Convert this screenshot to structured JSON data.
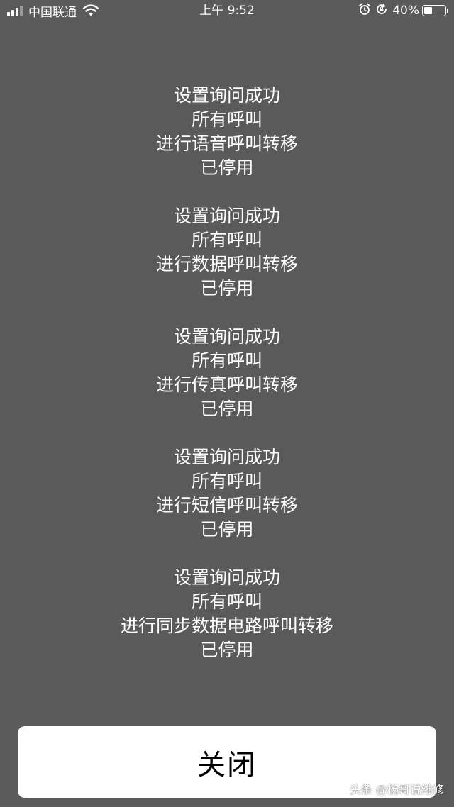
{
  "status_bar": {
    "carrier": "中国联通",
    "time": "上午 9:52",
    "battery_percent": "40%",
    "battery_level": 0.4,
    "icons": [
      "signal-icon",
      "wifi-icon",
      "alarm-icon",
      "rotation-lock-icon",
      "battery-icon"
    ]
  },
  "message": {
    "groups": [
      {
        "lines": [
          "设置询问成功",
          "所有呼叫",
          "进行语音呼叫转移",
          "已停用"
        ]
      },
      {
        "lines": [
          "设置询问成功",
          "所有呼叫",
          "进行数据呼叫转移",
          "已停用"
        ]
      },
      {
        "lines": [
          "设置询问成功",
          "所有呼叫",
          "进行传真呼叫转移",
          "已停用"
        ]
      },
      {
        "lines": [
          "设置询问成功",
          "所有呼叫",
          "进行短信呼叫转移",
          "已停用"
        ]
      },
      {
        "lines": [
          "设置询问成功",
          "所有呼叫",
          "进行同步数据电路呼叫转移",
          "已停用"
        ]
      }
    ]
  },
  "close_button": {
    "label": "关闭"
  },
  "watermark": "头条 @杨哥说维修",
  "colors": {
    "background": "#5a5a5a",
    "text": "#ffffff",
    "button_bg": "#ffffff",
    "button_text": "#000000"
  }
}
